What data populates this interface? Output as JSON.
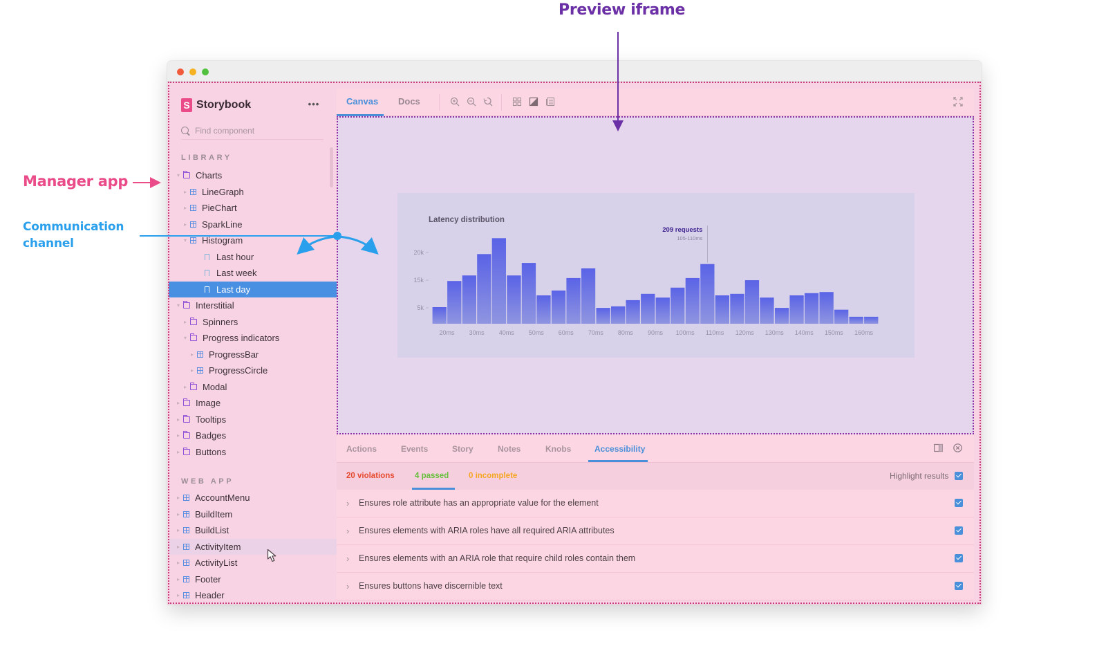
{
  "annotations": {
    "preview_iframe": "Preview iframe",
    "manager_app": "Manager app",
    "communication_channel_line1": "Communication",
    "communication_channel_line2": "channel",
    "colors": {
      "preview": "#6b2fa6",
      "manager": "#ea4c89",
      "channel": "#2aa0ec"
    }
  },
  "window": {
    "controls": [
      "close",
      "minimize",
      "maximize"
    ]
  },
  "sidebar": {
    "brand": {
      "logo_letter": "S",
      "name": "Storybook"
    },
    "more_label": "•••",
    "search": {
      "placeholder": "Find component",
      "value": ""
    },
    "sections": [
      {
        "title": "LIBRARY",
        "items": [
          {
            "label": "Charts",
            "type": "folder",
            "depth": 0,
            "expanded": true
          },
          {
            "label": "LineGraph",
            "type": "component",
            "depth": 1
          },
          {
            "label": "PieChart",
            "type": "component",
            "depth": 1
          },
          {
            "label": "SparkLine",
            "type": "component",
            "depth": 1
          },
          {
            "label": "Histogram",
            "type": "component",
            "depth": 1,
            "expanded": true
          },
          {
            "label": "Last hour",
            "type": "story",
            "depth": 2
          },
          {
            "label": "Last week",
            "type": "story",
            "depth": 2
          },
          {
            "label": "Last day",
            "type": "story",
            "depth": 2,
            "selected": true
          },
          {
            "label": "Interstitial",
            "type": "folder",
            "depth": 0,
            "expanded": true
          },
          {
            "label": "Spinners",
            "type": "folder",
            "depth": 1
          },
          {
            "label": "Progress indicators",
            "type": "folder",
            "depth": 1,
            "expanded": true
          },
          {
            "label": "ProgressBar",
            "type": "component",
            "depth": 2
          },
          {
            "label": "ProgressCircle",
            "type": "component",
            "depth": 2
          },
          {
            "label": "Modal",
            "type": "folder",
            "depth": 1
          },
          {
            "label": "Image",
            "type": "folder",
            "depth": 0
          },
          {
            "label": "Tooltips",
            "type": "folder",
            "depth": 0
          },
          {
            "label": "Badges",
            "type": "folder",
            "depth": 0
          },
          {
            "label": "Buttons",
            "type": "folder",
            "depth": 0
          }
        ]
      },
      {
        "title": "WEB APP",
        "items": [
          {
            "label": "AccountMenu",
            "type": "component",
            "depth": 0
          },
          {
            "label": "BuildItem",
            "type": "component",
            "depth": 0
          },
          {
            "label": "BuildList",
            "type": "component",
            "depth": 0
          },
          {
            "label": "ActivityItem",
            "type": "component",
            "depth": 0,
            "hover": true
          },
          {
            "label": "ActivityList",
            "type": "component",
            "depth": 0
          },
          {
            "label": "Footer",
            "type": "component",
            "depth": 0
          },
          {
            "label": "Header",
            "type": "component",
            "depth": 0
          }
        ]
      }
    ]
  },
  "toolbar": {
    "tabs": [
      {
        "label": "Canvas",
        "active": true
      },
      {
        "label": "Docs",
        "active": false
      }
    ],
    "icons": [
      "zoom-in-icon",
      "zoom-out-icon",
      "zoom-reset-icon",
      "grid-icon",
      "background-icon",
      "viewport-icon"
    ],
    "fullscreen_icon": "fullscreen-icon"
  },
  "chart_data": {
    "type": "bar",
    "title": "Latency distribution",
    "xlabel": "",
    "ylabel": "",
    "x_tick_labels": [
      "20ms",
      "30ms",
      "40ms",
      "50ms",
      "60ms",
      "70ms",
      "80ms",
      "90ms",
      "100ms",
      "110ms",
      "120ms",
      "130ms",
      "140ms",
      "150ms",
      "160ms"
    ],
    "y_tick_labels": [
      "20k",
      "15k",
      "5k"
    ],
    "bin_width_ms": 5,
    "bins_start_ms": 15,
    "values": [
      4.5,
      11.6,
      13.1,
      18.9,
      23.2,
      13.1,
      16.5,
      7.7,
      9.0,
      12.4,
      15.0,
      4.3,
      4.7,
      6.4,
      8.1,
      7.1,
      9.8,
      12.4,
      16.2,
      7.7,
      8.1,
      11.8,
      7.1,
      4.3,
      7.7,
      8.3,
      8.6,
      3.8,
      1.9,
      1.9
    ],
    "value_units": "k requests (approx., read against axis ticks)",
    "ylim": [
      0,
      24
    ],
    "grid": false,
    "tooltip": {
      "title": "209 requests",
      "subtitle": "105-110ms",
      "bin_index": 18
    },
    "bar_color": "#6b72e6"
  },
  "addons_panel": {
    "tabs": [
      {
        "label": "Actions",
        "active": false
      },
      {
        "label": "Events",
        "active": false
      },
      {
        "label": "Story",
        "active": false
      },
      {
        "label": "Notes",
        "active": false
      },
      {
        "label": "Knobs",
        "active": false
      },
      {
        "label": "Accessibility",
        "active": true
      }
    ],
    "summary": {
      "violations": {
        "label": "20 violations",
        "color": "#e6492f"
      },
      "passed": {
        "label": "4 passed",
        "color": "#66bf3c"
      },
      "incomplete": {
        "label": "0 incomplete",
        "color": "#f5a623"
      }
    },
    "highlight_results": {
      "label": "Highlight results",
      "checked": true
    },
    "rules": [
      {
        "text": "Ensures role attribute has an appropriate value for the element",
        "checked": true
      },
      {
        "text": "Ensures elements with ARIA roles have all required ARIA attributes",
        "checked": true
      },
      {
        "text": "Ensures elements with an ARIA role that require child roles contain them",
        "checked": true
      },
      {
        "text": "Ensures buttons have discernible text",
        "checked": true
      }
    ]
  }
}
